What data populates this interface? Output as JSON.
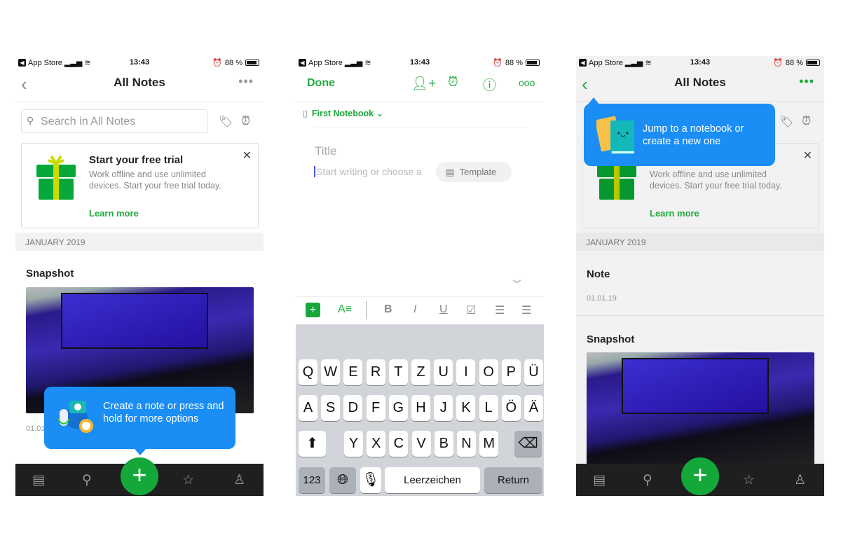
{
  "status": {
    "carrier": "App Store",
    "time": "13:43",
    "battery": "88 %"
  },
  "screen1": {
    "title": "All Notes",
    "search_placeholder": "Search in All Notes",
    "promo": {
      "title": "Start your free trial",
      "body": "Work offline and use unlimited devices. Start your free trial today.",
      "link": "Learn more"
    },
    "section": "JANUARY 2019",
    "note": {
      "title": "Snapshot",
      "date": "01.01.19"
    },
    "tooltip": "Create a note or press and hold for more options",
    "fab": "+"
  },
  "screen2": {
    "done": "Done",
    "notebook": "First Notebook",
    "title_placeholder": "Title",
    "body_placeholder": "Start writing or choose a",
    "template": "Template",
    "keyboard": {
      "row1": [
        "Q",
        "W",
        "E",
        "R",
        "T",
        "Z",
        "U",
        "I",
        "O",
        "P",
        "Ü"
      ],
      "row2": [
        "A",
        "S",
        "D",
        "F",
        "G",
        "H",
        "J",
        "K",
        "L",
        "Ö",
        "Ä"
      ],
      "row3": [
        "Y",
        "X",
        "C",
        "V",
        "B",
        "N",
        "M"
      ],
      "numbers": "123",
      "space": "Leerzeichen",
      "return": "Return"
    }
  },
  "screen3": {
    "title": "All Notes",
    "tooltip": "Jump to a notebook or create a new one",
    "promo": {
      "body": "Work offline and use unlimited devices. Start your free trial today.",
      "link": "Learn more"
    },
    "section": "JANUARY 2019",
    "notes": [
      {
        "title": "Note",
        "date": "01.01.19"
      },
      {
        "title": "Snapshot"
      }
    ]
  },
  "colors": {
    "accent": "#1faa3b",
    "tooltip": "#1a8ef5",
    "tabbar": "#1f1f1f"
  }
}
